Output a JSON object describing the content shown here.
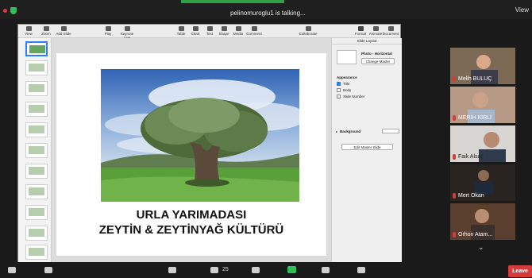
{
  "meeting": {
    "talking_status": "pelinomuroglu1 is talking...",
    "view_label": "View",
    "participant_count": "25",
    "leave_label": "Leave"
  },
  "keynote": {
    "toolbar": [
      {
        "label": "View",
        "icon": "sidebar-icon"
      },
      {
        "label": "Zoom",
        "icon": "zoom-icon"
      },
      {
        "label": "Add Slide",
        "icon": "plus-icon"
      },
      {
        "label": "Play",
        "icon": "play-icon"
      },
      {
        "label": "Keynote Live",
        "icon": "live-icon"
      },
      {
        "label": "Table",
        "icon": "table-icon"
      },
      {
        "label": "Chart",
        "icon": "chart-icon"
      },
      {
        "label": "Text",
        "icon": "text-icon"
      },
      {
        "label": "Shape",
        "icon": "shape-icon"
      },
      {
        "label": "Media",
        "icon": "media-icon"
      },
      {
        "label": "Comment",
        "icon": "comment-icon"
      },
      {
        "label": "Collaborate",
        "icon": "collaborate-icon"
      },
      {
        "label": "Format",
        "icon": "format-icon"
      },
      {
        "label": "Animate",
        "icon": "animate-icon"
      },
      {
        "label": "Document",
        "icon": "document-icon"
      }
    ],
    "slide_title_line1": "URLA YARIMADASI",
    "slide_title_line2": "ZEYTİN & ZEYTİNYAĞ KÜLTÜRÜ",
    "inspector": {
      "tab": "Slide Layout",
      "layout_name": "Photo - Horizontal",
      "change_master": "Change Master",
      "appearance": "Appearance",
      "title_label": "Title",
      "body_label": "Body",
      "slide_number_label": "Slide Number",
      "background_label": "Background",
      "edit_master": "Edit Master Slide"
    }
  },
  "participants": [
    {
      "name": "Melih BULUÇ"
    },
    {
      "name": "MERİH KIRLI"
    },
    {
      "name": "Faik Alsaç"
    },
    {
      "name": "Mert Okan"
    },
    {
      "name": "Orhon Atam..."
    }
  ]
}
